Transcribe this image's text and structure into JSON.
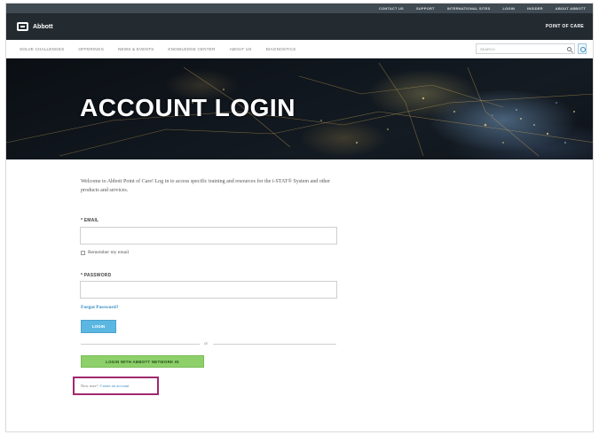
{
  "utility_bar": {
    "links": [
      "CONTACT US",
      "SUPPORT",
      "INTERNATIONAL SITES",
      "LOGIN",
      "INSIDER",
      "ABOUT ABBOTT"
    ]
  },
  "header": {
    "brand": "Abbott",
    "product": "POINT OF CARE"
  },
  "nav": {
    "items": [
      "SOLVE CHALLENGES",
      "OFFERINGS",
      "NEWS & EVENTS",
      "KNOWLEDGE CENTER",
      "ABOUT US",
      "DIAGNOSTICS"
    ],
    "search_placeholder": "SEARCH"
  },
  "hero": {
    "title": "ACCOUNT LOGIN"
  },
  "form": {
    "intro": "Welcome to Abbott Point of Care! Log in to access specific training and resources for the i-STAT® System and other products and services.",
    "email_label": "* EMAIL",
    "remember_label": "Remember my email",
    "password_label": "* PASSWORD",
    "forgot_label": "Forgot Password?",
    "login_button": "LOGIN",
    "or_label": "or",
    "network_button": "LOGIN WITH ABBOTT NETWORK ID",
    "new_user_text": "New user?",
    "new_user_link": "Create an account"
  },
  "colors": {
    "utility_bg": "#3f4a52",
    "header_bg": "#232a30",
    "login_button": "#5bb7e2",
    "network_button": "#8dd06a",
    "highlight_box": "#a0296e",
    "link": "#3a8cc4"
  },
  "icons": [
    "abbott-logo-icon",
    "search-icon",
    "sidebar-toggle-icon",
    "checkbox-icon"
  ]
}
